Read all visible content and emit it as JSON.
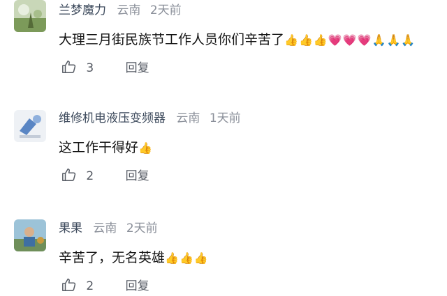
{
  "comments": [
    {
      "username": "兰梦魔力",
      "location": "云南",
      "time": "2天前",
      "text": "大理三月街民族节工作人员你们辛苦了",
      "emojis": [
        "👍",
        "👍",
        "👍",
        "💗",
        "💗",
        "💗",
        "🙏",
        "🙏",
        "🙏"
      ],
      "likes": "3",
      "reply_label": "回复"
    },
    {
      "username": "维修机电液压变频器",
      "location": "云南",
      "time": "1天前",
      "text": "这工作干得好",
      "emojis": [
        "👍"
      ],
      "likes": "2",
      "reply_label": "回复"
    },
    {
      "username": "果果",
      "location": "云南",
      "time": "2天前",
      "text": "辛苦了，无名英雄",
      "emojis": [
        "👍",
        "👍",
        "👍"
      ],
      "likes": "2",
      "reply_label": "回复"
    }
  ],
  "icons": {
    "like": "thumbs-up-outline-icon",
    "emoji_thumb": "thumbs-up-emoji-icon",
    "emoji_heart": "pink-heart-emoji-icon",
    "emoji_pray": "folded-hands-emoji-icon"
  },
  "colors": {
    "username": "#3d4a5c",
    "meta_gray": "#8a8f99",
    "action_gray": "#555a63"
  }
}
